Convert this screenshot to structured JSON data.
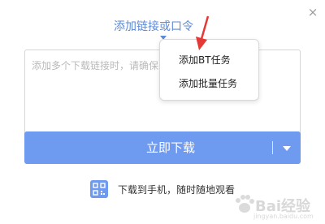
{
  "dialog": {
    "close_icon": "×",
    "title": "添加链接或口令"
  },
  "input": {
    "placeholder": "添加多个下载链接时，请确保"
  },
  "download_button": {
    "label": "立即下载"
  },
  "mobile": {
    "text": "下载到手机，随时随地观看"
  },
  "dropdown": {
    "items": [
      {
        "label": "添加BT任务"
      },
      {
        "label": "添加批量任务"
      }
    ]
  },
  "watermark": {
    "brand": "Bai经验",
    "sub": "jingyan.baidu.com"
  },
  "colors": {
    "accent": "#6e9af0",
    "title": "#5e8ad6",
    "annotation_arrow": "#e53935"
  }
}
